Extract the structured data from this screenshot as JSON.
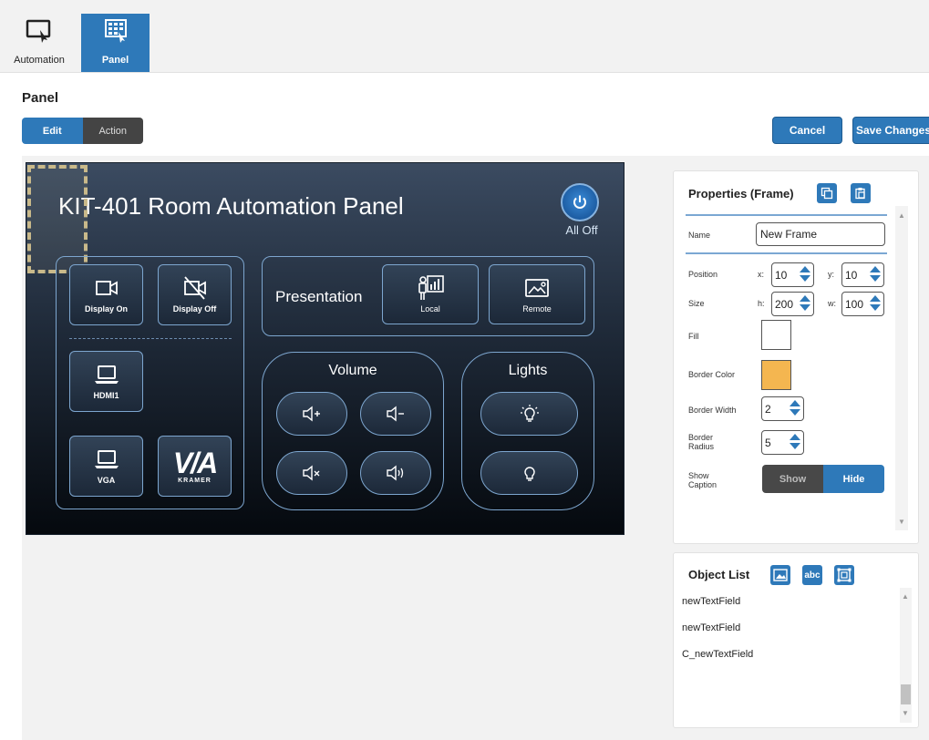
{
  "tabs": [
    {
      "label": "Automation",
      "icon": "monitor-cursor-icon",
      "active": false
    },
    {
      "label": "Panel",
      "icon": "grid-panel-icon",
      "active": true
    }
  ],
  "page": {
    "title": "Panel",
    "mode_tabs": [
      "Edit",
      "Action"
    ],
    "active_mode": "Edit",
    "cancel_label": "Cancel",
    "save_label": "Save Changes"
  },
  "panel": {
    "title": "KIT-401 Room Automation Panel",
    "all_off_label": "All Off",
    "buttons": {
      "display_on": "Display On",
      "display_off": "Display Off",
      "hdmi1": "HDMI1",
      "vga": "VGA",
      "via_logo": "V/A",
      "via_sub": "KRAMER",
      "local": "Local",
      "remote": "Remote"
    },
    "groups": {
      "presentation": "Presentation",
      "volume": "Volume",
      "lights": "Lights"
    },
    "colors": {
      "accent": "#2e79b9",
      "frame_outline": "#7da6cf"
    }
  },
  "properties": {
    "title": "Properties (Frame)",
    "name_label": "Name",
    "name_value": "New Frame",
    "position_label": "Position",
    "x_label": "x:",
    "x_value": "10",
    "y_label": "y:",
    "y_value": "10",
    "size_label": "Size",
    "h_label": "h:",
    "h_value": "200",
    "w_label": "w:",
    "w_value": "100",
    "fill_label": "Fill",
    "fill_color": "#ffffff",
    "border_color_label": "Border Color",
    "border_color": "#f4b650",
    "border_width_label": "Border Width",
    "border_width_value": "2",
    "border_radius_label_1": "Border",
    "border_radius_label_2": "Radius",
    "border_radius_value": "5",
    "show_caption_label_1": "Show",
    "show_caption_label_2": "Caption",
    "show_label": "Show",
    "hide_label": "Hide",
    "caption_state": "Hide"
  },
  "object_list": {
    "title": "Object List",
    "items": [
      "newTextField",
      "newTextField",
      "C_newTextField"
    ]
  }
}
